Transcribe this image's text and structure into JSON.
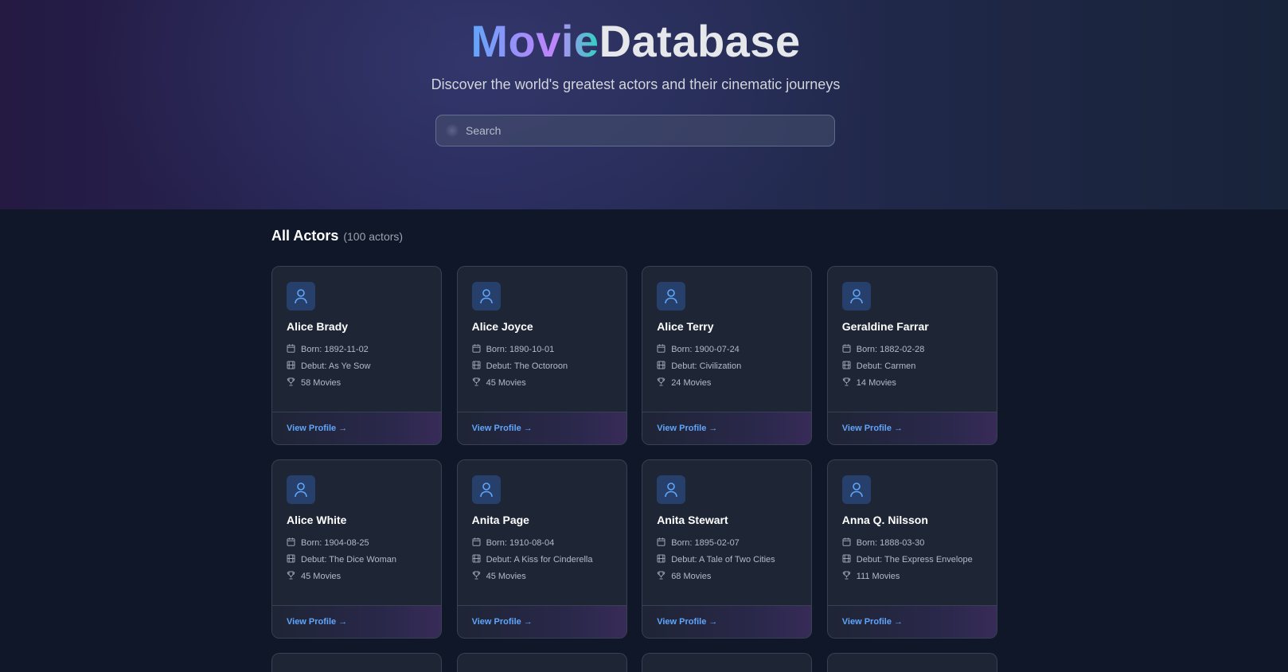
{
  "brand": {
    "title_part1": "Movie",
    "title_part2": "Database",
    "subtitle": "Discover the world's greatest actors and their cinematic journeys"
  },
  "search": {
    "placeholder": "Search",
    "value": ""
  },
  "section": {
    "title": "All Actors",
    "count": "(100 actors)"
  },
  "actors": [
    {
      "name": "Alice Brady",
      "born": "Born: 1892-11-02",
      "debut": "Debut: As Ye Sow",
      "movies": "58 Movies",
      "link": "View Profile →"
    },
    {
      "name": "Alice Joyce",
      "born": "Born: 1890-10-01",
      "debut": "Debut: The Octoroon",
      "movies": "45 Movies",
      "link": "View Profile →"
    },
    {
      "name": "Alice Terry",
      "born": "Born: 1900-07-24",
      "debut": "Debut: Civilization",
      "movies": "24 Movies",
      "link": "View Profile →"
    },
    {
      "name": "Geraldine Farrar",
      "born": "Born: 1882-02-28",
      "debut": "Debut: Carmen",
      "movies": "14 Movies",
      "link": "View Profile →"
    },
    {
      "name": "Alice White",
      "born": "Born: 1904-08-25",
      "debut": "Debut: The Dice Woman",
      "movies": "45 Movies",
      "link": "View Profile →"
    },
    {
      "name": "Anita Page",
      "born": "Born: 1910-08-04",
      "debut": "Debut: A Kiss for Cinderella",
      "movies": "45 Movies",
      "link": "View Profile →"
    },
    {
      "name": "Anita Stewart",
      "born": "Born: 1895-02-07",
      "debut": "Debut: A Tale of Two Cities",
      "movies": "68 Movies",
      "link": "View Profile →"
    },
    {
      "name": "Anna Q. Nilsson",
      "born": "Born: 1888-03-30",
      "debut": "Debut: The Express Envelope",
      "movies": "111 Movies",
      "link": "View Profile →"
    }
  ],
  "colors": {
    "accent": "#60a5fa",
    "background": "#0f1729",
    "card": "#1e2535"
  },
  "icons": {
    "avatar": "user-icon",
    "born": "calendar-icon",
    "debut": "film-icon",
    "movies": "trophy-icon"
  }
}
